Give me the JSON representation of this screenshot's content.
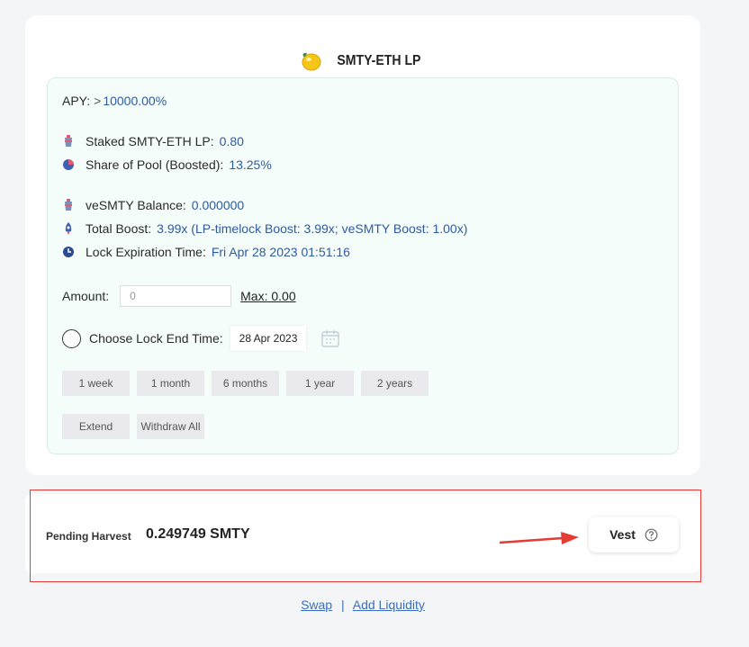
{
  "pool": {
    "title": "SMTY-ETH LP",
    "icon": "lemon-icon"
  },
  "stats": {
    "apy_label": "APY:",
    "apy_prefix": ">",
    "apy_value": "10000.00%",
    "staked_label": "Staked SMTY-ETH LP:",
    "staked_value": "0.80",
    "share_label": "Share of Pool (Boosted):",
    "share_value": "13.25%",
    "vesmty_label": "veSMTY Balance:",
    "vesmty_value": "0.000000",
    "boost_label": "Total Boost:",
    "boost_value": "3.99x (LP-timelock Boost: 3.99x; veSMTY Boost: 1.00x)",
    "lock_label": "Lock Expiration Time:",
    "lock_value": "Fri Apr 28 2023 01:51:16"
  },
  "form": {
    "amount_label": "Amount:",
    "amount_placeholder": "0",
    "max_label": "Max: 0.00",
    "lock_end_label": "Choose Lock End Time:",
    "lock_end_date": "28 Apr 2023",
    "durations": [
      "1 week",
      "1 month",
      "6 months",
      "1 year",
      "2 years"
    ],
    "extend_label": "Extend",
    "withdraw_label": "Withdraw All"
  },
  "harvest": {
    "label": "Pending Harvest",
    "value": "0.249749 SMTY",
    "vest_label": "Vest"
  },
  "footer": {
    "swap": "Swap",
    "separator": "|",
    "add_liquidity": "Add Liquidity"
  },
  "colors": {
    "value_blue": "#2f5a9e",
    "link_blue": "#3a6fbf",
    "highlight_red": "#e53b35",
    "button_gray": "#eaeaee"
  }
}
